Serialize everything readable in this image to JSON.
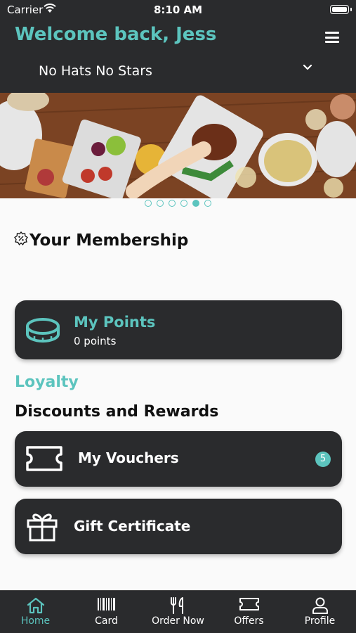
{
  "status_bar": {
    "carrier": "Carrier",
    "time": "8:10 AM"
  },
  "header": {
    "welcome": "Welcome back, Jess",
    "location": "No Hats No Stars"
  },
  "carousel": {
    "page_count": 6,
    "active_index": 4
  },
  "membership": {
    "title": "Your Membership"
  },
  "points": {
    "label": "My Points",
    "value": "0 points"
  },
  "loyalty": {
    "heading": "Loyalty",
    "subheading": "Discounts and Rewards"
  },
  "vouchers": {
    "label": "My Vouchers",
    "count": "5"
  },
  "gift": {
    "label": "Gift Certificate"
  },
  "tabs": [
    {
      "label": "Home",
      "icon": "home-icon"
    },
    {
      "label": "Card",
      "icon": "barcode-icon"
    },
    {
      "label": "Order Now",
      "icon": "utensils-icon"
    },
    {
      "label": "Offers",
      "icon": "ticket-icon"
    },
    {
      "label": "Profile",
      "icon": "user-icon"
    }
  ],
  "colors": {
    "accent": "#5cc4be",
    "dark": "#2a2b2d",
    "background": "#fafafa"
  }
}
